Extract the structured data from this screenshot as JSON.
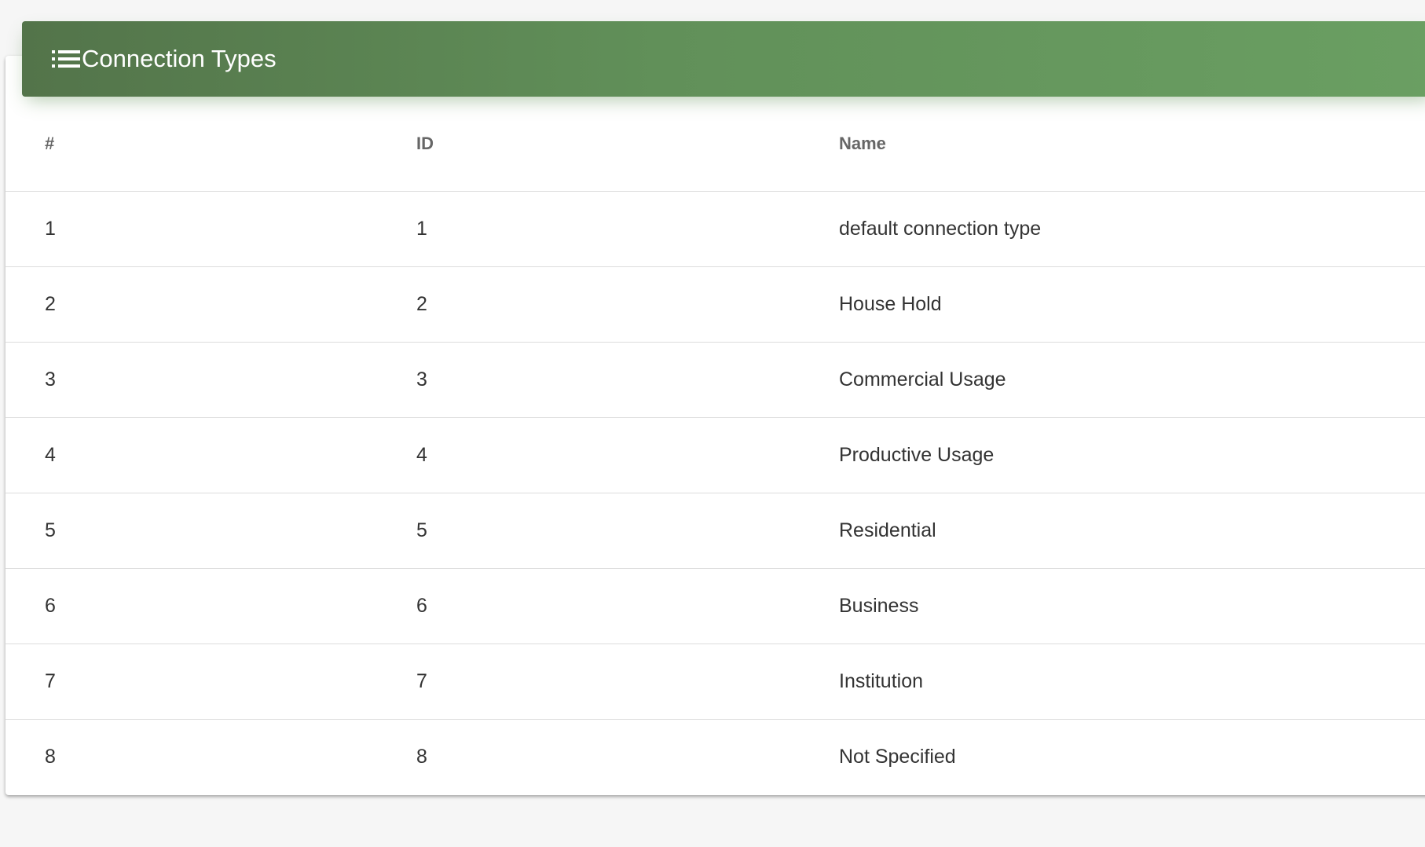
{
  "header": {
    "title": "Connection Types",
    "icon": "list-icon",
    "colors": {
      "gradient_start": "#53744a",
      "gradient_end": "#6a9f62"
    }
  },
  "table": {
    "columns": [
      "#",
      "ID",
      "Name"
    ],
    "rows": [
      {
        "index": "1",
        "id": "1",
        "name": "default connection type"
      },
      {
        "index": "2",
        "id": "2",
        "name": "House Hold"
      },
      {
        "index": "3",
        "id": "3",
        "name": "Commercial Usage"
      },
      {
        "index": "4",
        "id": "4",
        "name": "Productive Usage"
      },
      {
        "index": "5",
        "id": "5",
        "name": "Residential"
      },
      {
        "index": "6",
        "id": "6",
        "name": "Business"
      },
      {
        "index": "7",
        "id": "7",
        "name": "Institution"
      },
      {
        "index": "8",
        "id": "8",
        "name": "Not Specified"
      }
    ]
  }
}
